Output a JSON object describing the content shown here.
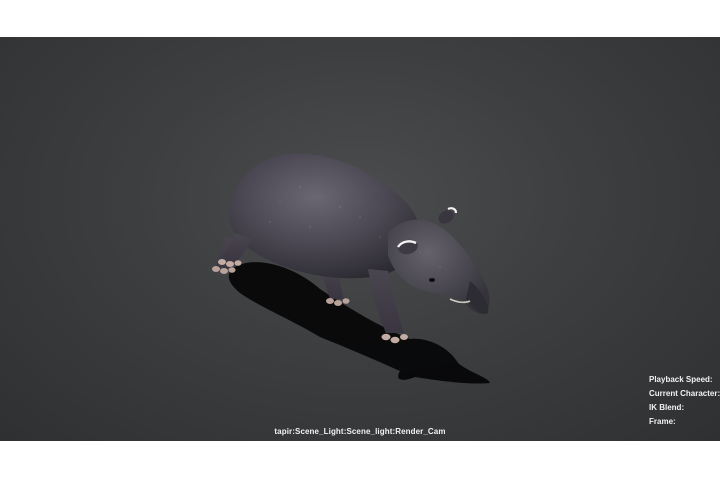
{
  "viewport": {
    "background_color": "#3e4042",
    "subject_icon": "tapir-3d-model",
    "camera_label": "tapir:Scene_Light:Scene_light:Render_Cam"
  },
  "hud": {
    "rows": [
      {
        "label": "Playback Speed:"
      },
      {
        "label": "Current Character:"
      },
      {
        "label": "IK Blend:"
      },
      {
        "label": "Frame:"
      }
    ]
  }
}
